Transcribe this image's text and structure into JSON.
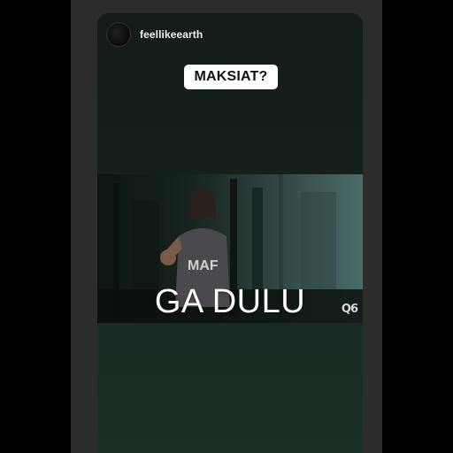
{
  "story": {
    "username": "feellikeearth",
    "sticker_text": "MAKSIAT?",
    "caption": "GA DULU",
    "watermark": "Q6"
  },
  "colors": {
    "frame": "#2b2d2b",
    "story_bg": "#15211b",
    "sticker_bg": "#ffffff"
  }
}
